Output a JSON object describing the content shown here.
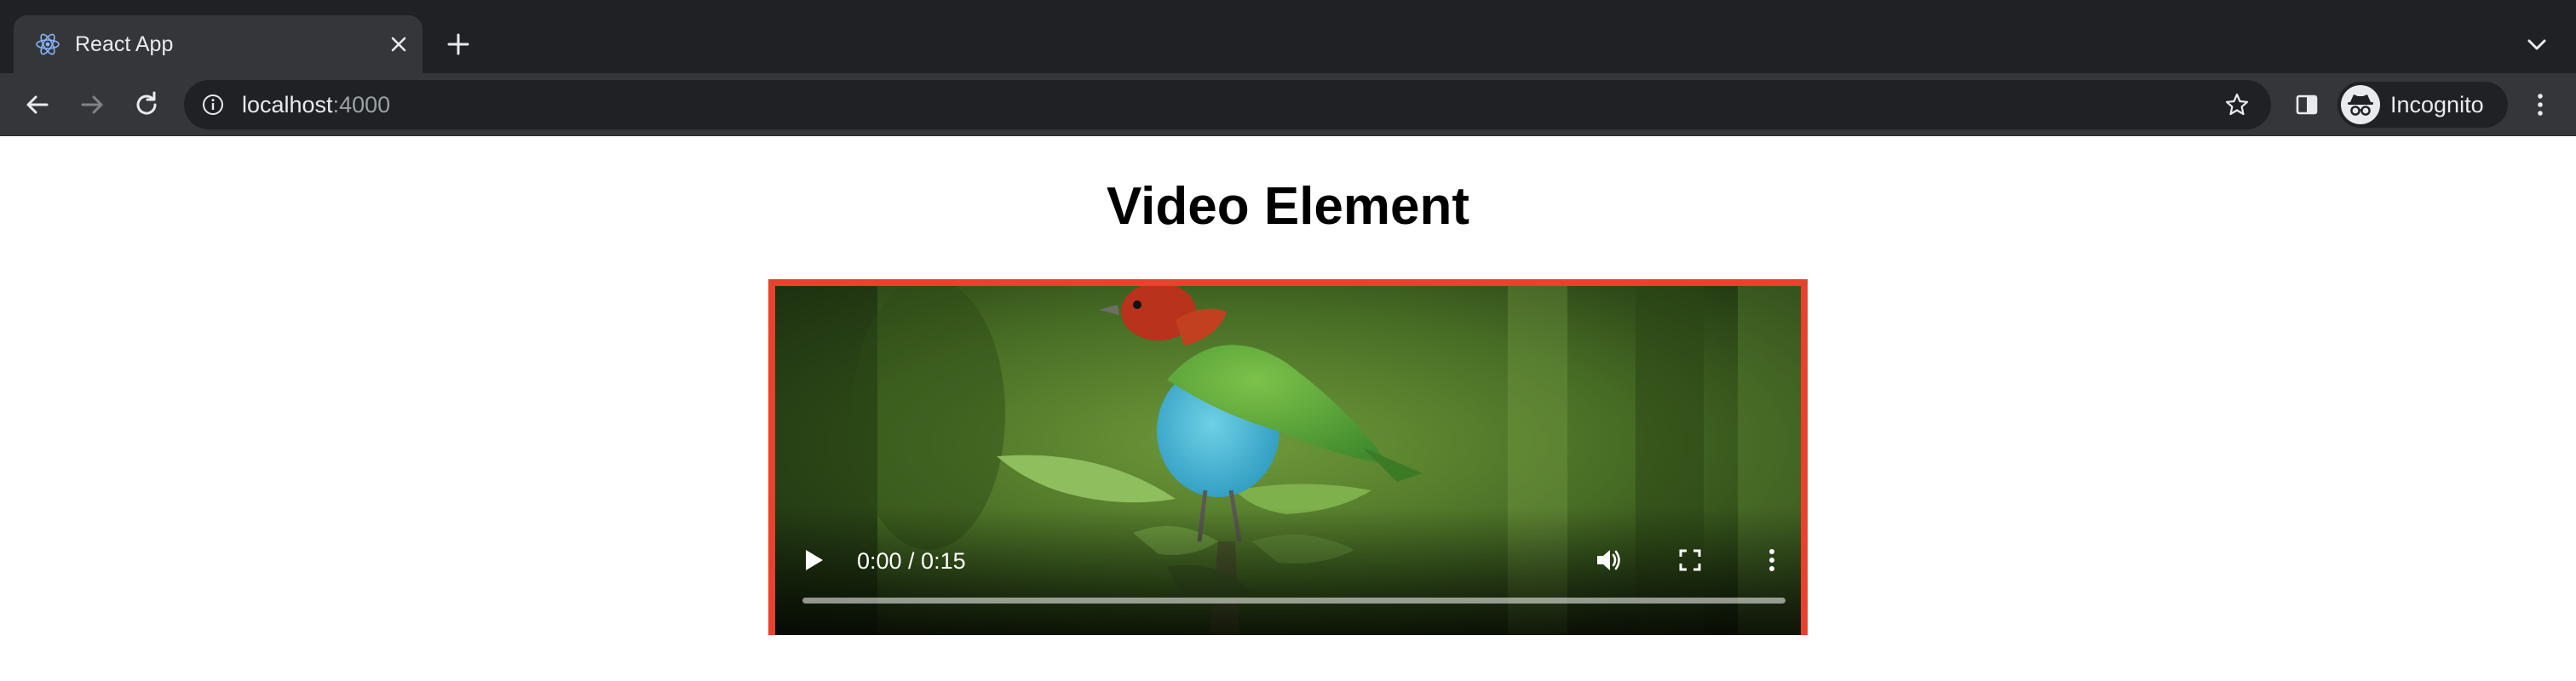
{
  "browser": {
    "tab": {
      "title": "React App",
      "favicon": "react-logo-icon"
    },
    "address": {
      "host": "localhost",
      "port": ":4000"
    },
    "profile": {
      "label": "Incognito"
    },
    "icons": {
      "back": "back-arrow-icon",
      "forward": "forward-arrow-icon",
      "reload": "reload-icon",
      "info": "info-icon",
      "star": "star-icon",
      "side_panel": "side-panel-icon",
      "menu": "kebab-menu-icon",
      "new_tab": "plus-icon",
      "tab_search": "chevron-down-icon",
      "close_tab": "close-icon"
    }
  },
  "page": {
    "heading": "Video Element",
    "video": {
      "time": "0:00 / 0:15",
      "progress": 0,
      "border_color": "#e8412c"
    }
  },
  "colors": {
    "chrome_frame": "#202124",
    "chrome_toolbar": "#35363a",
    "text_light": "#e8eaed"
  }
}
